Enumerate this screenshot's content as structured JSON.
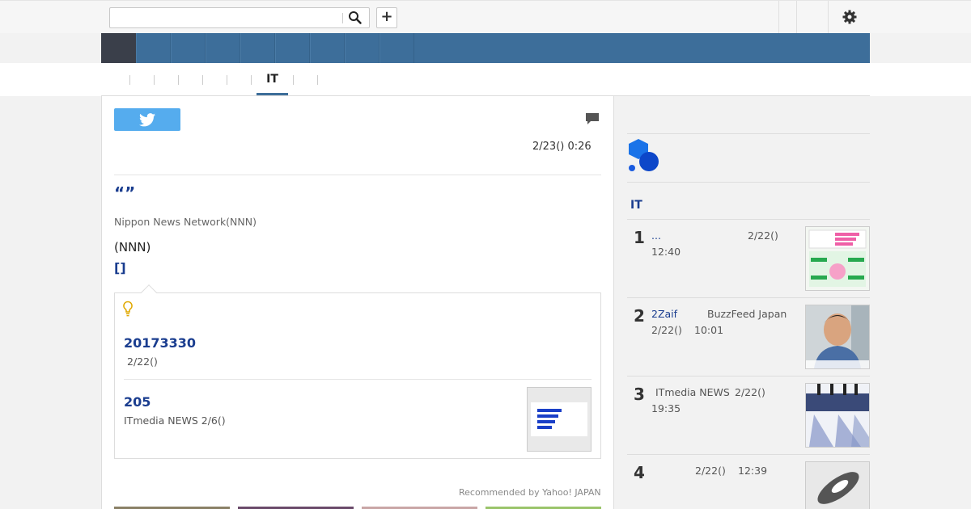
{
  "header": {
    "search_placeholder": "",
    "search_icon": "search-icon",
    "add_icon_label": "+",
    "settings_icon": "gear-icon"
  },
  "subtabs": {
    "active_label": "IT"
  },
  "article": {
    "datetime": "2/23() 0:26",
    "title_quote": "“”",
    "source": "Nippon News Network(NNN)",
    "body_line1": "(NNN)",
    "body_link": "[]",
    "related": [
      {
        "title": "20173330",
        "meta": "2/22()"
      },
      {
        "title": "205",
        "meta": "ITmedia NEWS 2/6()"
      }
    ],
    "recommended": "Recommended by Yahoo! JAPAN"
  },
  "ranking": {
    "heading": "IT",
    "items": [
      {
        "rank": "1",
        "title": "...",
        "source": "",
        "date": "2/22()",
        "time": "12:40"
      },
      {
        "rank": "2",
        "title": "2Zaif",
        "source": "BuzzFeed Japan",
        "date": "2/22()",
        "time": "10:01"
      },
      {
        "rank": "3",
        "title": "",
        "source": "ITmedia NEWS",
        "date": "2/22()",
        "time": "19:35"
      },
      {
        "rank": "4",
        "title": "",
        "source": "",
        "date": "2/22()",
        "time": "12:39"
      }
    ]
  },
  "colors": {
    "nav_blue": "#3d6e9a",
    "link_blue": "#1a3d8f",
    "twitter_blue": "#55acee"
  }
}
